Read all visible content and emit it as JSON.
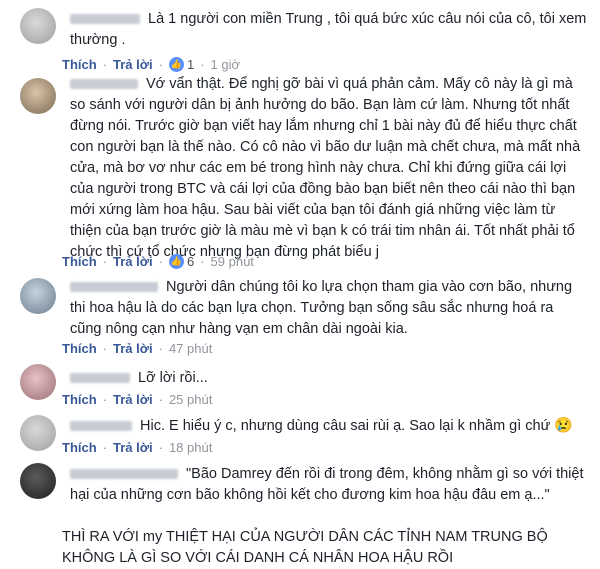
{
  "comments": [
    {
      "text": "Là 1 người con miền Trung , tôi quá bức xúc câu nói của cô, tôi xem thường .",
      "actions": {
        "like": "Thích",
        "reply": "Trả lời",
        "reaction_count": "1",
        "time": "1 giờ"
      }
    },
    {
      "text": "Vớ vẩn thật. Để nghị gỡ bài vì quá phản cảm. Mấy cô này là gì mà so sánh với người dân bị ảnh hưởng do bão. Bạn làm cứ làm. Nhưng tốt nhất đừng nói. Trước giờ bạn viết hay lắm nhưng chỉ 1 bài này đủ để hiểu thực chất con người bạn là thế nào. Có cô nào vì bão dư luận mà chết chưa, mà mất nhà cửa, mà bơ vơ như các em bé trong hình này chưa. Chỉ khi đứng giữa cái lợi của người trong BTC và cái lợi của đồng bào bạn biết nên theo cái nào thì bạn mới xứng làm hoa hậu. Sau bài viết của bạn tôi đánh giá những việc làm từ thiện của bạn trước giờ là màu mè vì bạn k có trái tim nhân ái. Tốt nhất phải tổ chức thì cứ tổ chức nhưng bạn đừng phát biểu j",
      "actions": {
        "like": "Thích",
        "reply": "Trả lời",
        "reaction_count": "6",
        "time": "59 phút"
      }
    },
    {
      "text": "Người dân chúng tôi ko lựa chọn tham gia vào cơn bão, nhưng thi hoa hậu là do các bạn lựa chọn. Tưởng bạn sống sâu sắc nhưng hoá ra cũng nông cạn như hàng vạn em chân dài ngoài kia.",
      "actions": {
        "like": "Thích",
        "reply": "Trả lời",
        "time": "47 phút"
      }
    },
    {
      "text": "Lỡ lời rồi...",
      "actions": {
        "like": "Thích",
        "reply": "Trả lời",
        "time": "25 phút"
      }
    },
    {
      "text": "Hic. E hiểu ý c, nhưng dùng câu sai rùi ạ. Sao lại k nhầm gì chứ",
      "emoji": "😢",
      "actions": {
        "like": "Thích",
        "reply": "Trả lời",
        "time": "18 phút"
      }
    },
    {
      "text": "\"Bão Damrey đến rồi đi trong đêm, không nhằm gì so với thiệt hại của những cơn bão không hồi kết cho đương kim hoa hậu đâu em ạ...\"",
      "text2": "THÌ RA VỚI my THIỆT HẠI CỦA NGƯỜI DÂN CÁC TỈNH NAM TRUNG BỘ KHÔNG LÀ GÌ SO VỚI CÁI DANH CÁ NHÂN HOA HẬU RỒI"
    }
  ]
}
